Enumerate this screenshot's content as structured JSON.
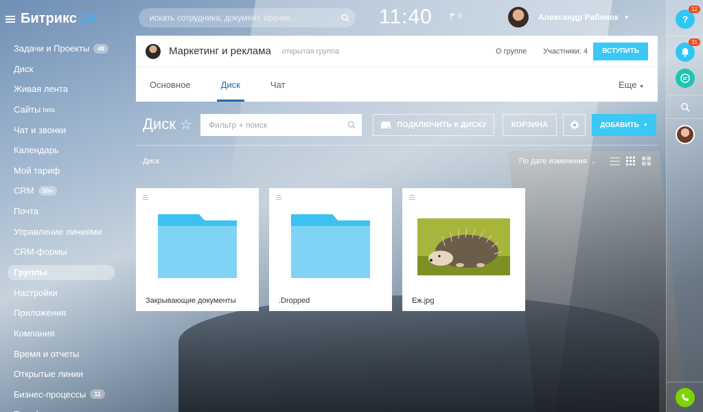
{
  "app": {
    "logo_name": "Битрикс",
    "logo_number": "24"
  },
  "sidebar": {
    "items": [
      {
        "label": "Задачи и Проекты",
        "badge": "48"
      },
      {
        "label": "Диск"
      },
      {
        "label": "Живая лента"
      },
      {
        "label": "Сайты",
        "sup": "beta"
      },
      {
        "label": "Чат и звонки"
      },
      {
        "label": "Календарь"
      },
      {
        "label": "Мой тариф"
      },
      {
        "label": "CRM",
        "badge": "50+"
      },
      {
        "label": "Почта"
      },
      {
        "label": "Управление линиями"
      },
      {
        "label": "CRM-формы"
      },
      {
        "label": "Группы",
        "active": true
      },
      {
        "label": "Настройки"
      },
      {
        "label": "Приложения"
      },
      {
        "label": "Компания"
      },
      {
        "label": "Время и отчеты"
      },
      {
        "label": "Открытые линии"
      },
      {
        "label": "Бизнес-процессы",
        "badge": "11"
      },
      {
        "label": "Телефония"
      }
    ]
  },
  "topbar": {
    "search_placeholder": "искать сотрудника, документ, прочее...",
    "clock": "11:40",
    "flag_count": "0",
    "user_name": "Александр Рабенок"
  },
  "rightpanel": {
    "help_label": "?",
    "help_count": "12",
    "notifications_count": "31",
    "colors": {
      "help": "#2fc6f6",
      "notify": "#2fc6f6",
      "chat": "#1ec6b0",
      "phone": "#7bd500"
    }
  },
  "group": {
    "title": "Маркетинг и реклама",
    "type": "открытая группа",
    "about": "О группе",
    "members": "Участники: 4",
    "join": "ВСТУПИТЬ",
    "tabs": [
      "Основное",
      "Диск",
      "Чат"
    ],
    "active_tab": "Диск",
    "more": "Еще"
  },
  "disk": {
    "title": "Диск",
    "filter_placeholder": "Фильтр + поиск",
    "connect": "ПОДКЛЮЧИТЬ К ДИСКУ",
    "trash": "КОРЗИНА",
    "add": "ДОБАВИТЬ",
    "breadcrumb": "Диск",
    "sort": "По дате изменения",
    "items": [
      {
        "name": "Закрывающие документы",
        "kind": "folder"
      },
      {
        "name": ".Dropped",
        "kind": "folder"
      },
      {
        "name": "Еж.jpg",
        "kind": "image"
      }
    ],
    "accent": "#3bc8f5"
  }
}
